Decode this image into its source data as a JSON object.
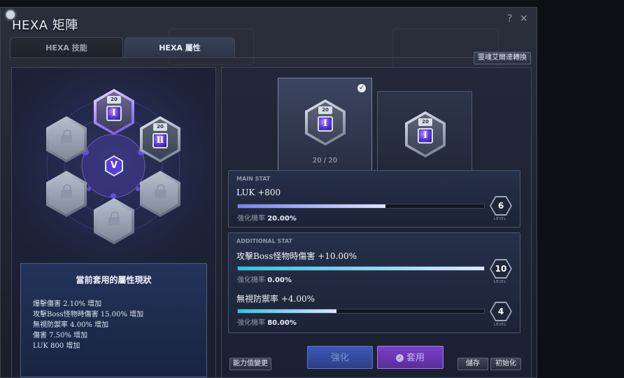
{
  "window": {
    "title": "HEXA 矩陣",
    "help": "?",
    "close": "✕"
  },
  "tabs": [
    {
      "label": "HEXA 技能"
    },
    {
      "label": "HEXA 屬性"
    }
  ],
  "convert_button": "靈魂艾爾達轉換",
  "matrix": {
    "selected_level": "20",
    "cores": [
      {
        "roman": "Ⅰ",
        "level": "20",
        "state": "active"
      },
      {
        "roman": "Ⅱ",
        "level": "20",
        "state": "unlocked"
      },
      {
        "state": "locked"
      },
      {
        "state": "locked"
      },
      {
        "state": "locked"
      },
      {
        "state": "locked"
      }
    ]
  },
  "status_box": {
    "title": "當前套用的屬性現狀",
    "lines": [
      "爆擊傷害 2.10% 增加",
      "攻擊Boss怪物時傷害 15.00% 增加",
      "無視防禦率 4.00% 增加",
      "傷害 7.50% 增加",
      "LUK 800 增加"
    ]
  },
  "preview": {
    "current": {
      "level": "20",
      "roman": "Ⅰ",
      "progress": "20 / 20",
      "checked": true
    },
    "next": {
      "level": "20",
      "roman": "Ⅰ"
    }
  },
  "main_stat": {
    "header": "MAIN STAT",
    "name": "LUK +800",
    "rate_label": "強化機率",
    "rate_value": "20.00%",
    "level": "6",
    "level_label": "LEVEL",
    "progress": 0.6
  },
  "additional_stat": {
    "header": "ADDITIONAL STAT",
    "items": [
      {
        "name": "攻擊Boss怪物時傷害 +10.00%",
        "rate_label": "強化機率",
        "rate_value": "0.00%",
        "level": "10",
        "level_label": "LEVEL",
        "progress": 1.0
      },
      {
        "name": "無視防禦率 +4.00%",
        "rate_label": "強化機率",
        "rate_value": "80.00%",
        "level": "4",
        "level_label": "LEVEL",
        "progress": 0.4
      }
    ]
  },
  "buttons": {
    "change_stat": "能力值變更",
    "enhance": "強化",
    "apply": "套用",
    "save": "儲存",
    "reset": "初始化"
  },
  "colors": {
    "main_bar": "#7b7ff0",
    "add_bar": "#2ac6e6",
    "apply_bg": "#7a3fc7",
    "enhance_bg": "#3c59b8"
  }
}
